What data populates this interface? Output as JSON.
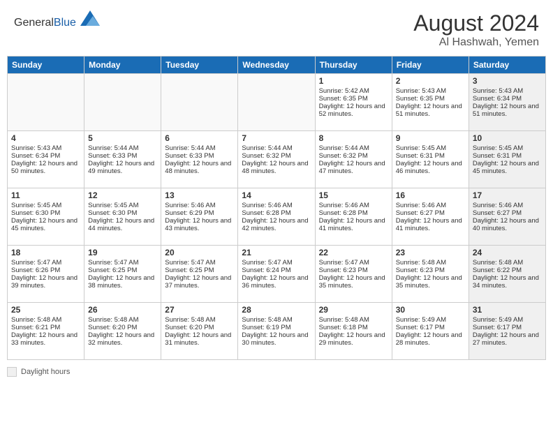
{
  "header": {
    "logo_general": "General",
    "logo_blue": "Blue",
    "month_year": "August 2024",
    "location": "Al Hashwah, Yemen"
  },
  "weekdays": [
    "Sunday",
    "Monday",
    "Tuesday",
    "Wednesday",
    "Thursday",
    "Friday",
    "Saturday"
  ],
  "legend": {
    "label": "Daylight hours"
  },
  "weeks": [
    [
      {
        "day": "",
        "sunrise": "",
        "sunset": "",
        "daylight": "",
        "empty": true
      },
      {
        "day": "",
        "sunrise": "",
        "sunset": "",
        "daylight": "",
        "empty": true
      },
      {
        "day": "",
        "sunrise": "",
        "sunset": "",
        "daylight": "",
        "empty": true
      },
      {
        "day": "",
        "sunrise": "",
        "sunset": "",
        "daylight": "",
        "empty": true
      },
      {
        "day": "1",
        "sunrise": "Sunrise: 5:42 AM",
        "sunset": "Sunset: 6:35 PM",
        "daylight": "Daylight: 12 hours and 52 minutes."
      },
      {
        "day": "2",
        "sunrise": "Sunrise: 5:43 AM",
        "sunset": "Sunset: 6:35 PM",
        "daylight": "Daylight: 12 hours and 51 minutes."
      },
      {
        "day": "3",
        "sunrise": "Sunrise: 5:43 AM",
        "sunset": "Sunset: 6:34 PM",
        "daylight": "Daylight: 12 hours and 51 minutes.",
        "shaded": true
      }
    ],
    [
      {
        "day": "4",
        "sunrise": "Sunrise: 5:43 AM",
        "sunset": "Sunset: 6:34 PM",
        "daylight": "Daylight: 12 hours and 50 minutes."
      },
      {
        "day": "5",
        "sunrise": "Sunrise: 5:44 AM",
        "sunset": "Sunset: 6:33 PM",
        "daylight": "Daylight: 12 hours and 49 minutes."
      },
      {
        "day": "6",
        "sunrise": "Sunrise: 5:44 AM",
        "sunset": "Sunset: 6:33 PM",
        "daylight": "Daylight: 12 hours and 48 minutes."
      },
      {
        "day": "7",
        "sunrise": "Sunrise: 5:44 AM",
        "sunset": "Sunset: 6:32 PM",
        "daylight": "Daylight: 12 hours and 48 minutes."
      },
      {
        "day": "8",
        "sunrise": "Sunrise: 5:44 AM",
        "sunset": "Sunset: 6:32 PM",
        "daylight": "Daylight: 12 hours and 47 minutes."
      },
      {
        "day": "9",
        "sunrise": "Sunrise: 5:45 AM",
        "sunset": "Sunset: 6:31 PM",
        "daylight": "Daylight: 12 hours and 46 minutes."
      },
      {
        "day": "10",
        "sunrise": "Sunrise: 5:45 AM",
        "sunset": "Sunset: 6:31 PM",
        "daylight": "Daylight: 12 hours and 45 minutes.",
        "shaded": true
      }
    ],
    [
      {
        "day": "11",
        "sunrise": "Sunrise: 5:45 AM",
        "sunset": "Sunset: 6:30 PM",
        "daylight": "Daylight: 12 hours and 45 minutes."
      },
      {
        "day": "12",
        "sunrise": "Sunrise: 5:45 AM",
        "sunset": "Sunset: 6:30 PM",
        "daylight": "Daylight: 12 hours and 44 minutes."
      },
      {
        "day": "13",
        "sunrise": "Sunrise: 5:46 AM",
        "sunset": "Sunset: 6:29 PM",
        "daylight": "Daylight: 12 hours and 43 minutes."
      },
      {
        "day": "14",
        "sunrise": "Sunrise: 5:46 AM",
        "sunset": "Sunset: 6:28 PM",
        "daylight": "Daylight: 12 hours and 42 minutes."
      },
      {
        "day": "15",
        "sunrise": "Sunrise: 5:46 AM",
        "sunset": "Sunset: 6:28 PM",
        "daylight": "Daylight: 12 hours and 41 minutes."
      },
      {
        "day": "16",
        "sunrise": "Sunrise: 5:46 AM",
        "sunset": "Sunset: 6:27 PM",
        "daylight": "Daylight: 12 hours and 41 minutes."
      },
      {
        "day": "17",
        "sunrise": "Sunrise: 5:46 AM",
        "sunset": "Sunset: 6:27 PM",
        "daylight": "Daylight: 12 hours and 40 minutes.",
        "shaded": true
      }
    ],
    [
      {
        "day": "18",
        "sunrise": "Sunrise: 5:47 AM",
        "sunset": "Sunset: 6:26 PM",
        "daylight": "Daylight: 12 hours and 39 minutes."
      },
      {
        "day": "19",
        "sunrise": "Sunrise: 5:47 AM",
        "sunset": "Sunset: 6:25 PM",
        "daylight": "Daylight: 12 hours and 38 minutes."
      },
      {
        "day": "20",
        "sunrise": "Sunrise: 5:47 AM",
        "sunset": "Sunset: 6:25 PM",
        "daylight": "Daylight: 12 hours and 37 minutes."
      },
      {
        "day": "21",
        "sunrise": "Sunrise: 5:47 AM",
        "sunset": "Sunset: 6:24 PM",
        "daylight": "Daylight: 12 hours and 36 minutes."
      },
      {
        "day": "22",
        "sunrise": "Sunrise: 5:47 AM",
        "sunset": "Sunset: 6:23 PM",
        "daylight": "Daylight: 12 hours and 35 minutes."
      },
      {
        "day": "23",
        "sunrise": "Sunrise: 5:48 AM",
        "sunset": "Sunset: 6:23 PM",
        "daylight": "Daylight: 12 hours and 35 minutes."
      },
      {
        "day": "24",
        "sunrise": "Sunrise: 5:48 AM",
        "sunset": "Sunset: 6:22 PM",
        "daylight": "Daylight: 12 hours and 34 minutes.",
        "shaded": true
      }
    ],
    [
      {
        "day": "25",
        "sunrise": "Sunrise: 5:48 AM",
        "sunset": "Sunset: 6:21 PM",
        "daylight": "Daylight: 12 hours and 33 minutes."
      },
      {
        "day": "26",
        "sunrise": "Sunrise: 5:48 AM",
        "sunset": "Sunset: 6:20 PM",
        "daylight": "Daylight: 12 hours and 32 minutes."
      },
      {
        "day": "27",
        "sunrise": "Sunrise: 5:48 AM",
        "sunset": "Sunset: 6:20 PM",
        "daylight": "Daylight: 12 hours and 31 minutes."
      },
      {
        "day": "28",
        "sunrise": "Sunrise: 5:48 AM",
        "sunset": "Sunset: 6:19 PM",
        "daylight": "Daylight: 12 hours and 30 minutes."
      },
      {
        "day": "29",
        "sunrise": "Sunrise: 5:48 AM",
        "sunset": "Sunset: 6:18 PM",
        "daylight": "Daylight: 12 hours and 29 minutes."
      },
      {
        "day": "30",
        "sunrise": "Sunrise: 5:49 AM",
        "sunset": "Sunset: 6:17 PM",
        "daylight": "Daylight: 12 hours and 28 minutes."
      },
      {
        "day": "31",
        "sunrise": "Sunrise: 5:49 AM",
        "sunset": "Sunset: 6:17 PM",
        "daylight": "Daylight: 12 hours and 27 minutes.",
        "shaded": true
      }
    ]
  ]
}
